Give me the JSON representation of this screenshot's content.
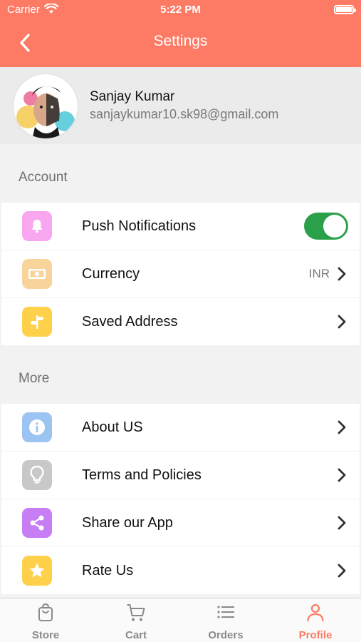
{
  "status_bar": {
    "carrier": "Carrier",
    "time": "5:22 PM"
  },
  "header": {
    "title": "Settings",
    "color": "#fd7a64"
  },
  "profile": {
    "name": "Sanjay Kumar",
    "email": "sanjaykumar10.sk98@gmail.com"
  },
  "sections": {
    "account": {
      "label": "Account",
      "items": [
        {
          "label": "Push Notifications",
          "icon": "bell-icon",
          "icon_color": "#f9a6f0",
          "toggle_on": true
        },
        {
          "label": "Currency",
          "icon": "banknote-icon",
          "icon_color": "#f8d49a",
          "value": "INR"
        },
        {
          "label": "Saved Address",
          "icon": "signpost-icon",
          "icon_color": "#ffd04a"
        }
      ]
    },
    "more": {
      "label": "More",
      "items": [
        {
          "label": "About US",
          "icon": "info-icon",
          "icon_color": "#9cc4f2"
        },
        {
          "label": "Terms and Policies",
          "icon": "lightbulb-icon",
          "icon_color": "#c8c8c8"
        },
        {
          "label": "Share our App",
          "icon": "share-icon",
          "icon_color": "#c77ef5"
        },
        {
          "label": "Rate Us",
          "icon": "star-icon",
          "icon_color": "#ffd04a"
        }
      ]
    }
  },
  "tabbar": {
    "tabs": [
      {
        "label": "Store",
        "icon": "bag-icon"
      },
      {
        "label": "Cart",
        "icon": "cart-icon"
      },
      {
        "label": "Orders",
        "icon": "list-icon"
      },
      {
        "label": "Profile",
        "icon": "person-icon",
        "active": true
      }
    ],
    "active_color": "#fd7a64"
  }
}
